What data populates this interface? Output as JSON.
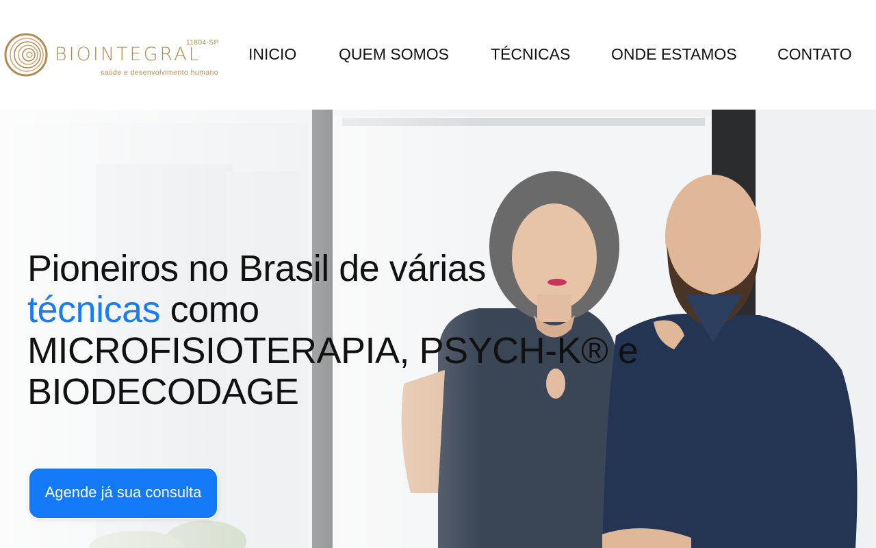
{
  "brand": {
    "name": "BIOINTEGRAL",
    "code": "11804-SP",
    "tagline": "saúde e desenvolvimento humano",
    "color": "#b08a52"
  },
  "nav": {
    "items": [
      {
        "label": "INICIO"
      },
      {
        "label": "QUEM SOMOS"
      },
      {
        "label": "TÉCNICAS"
      },
      {
        "label": "ONDE ESTAMOS"
      },
      {
        "label": "CONTATO"
      }
    ]
  },
  "hero": {
    "headline_part1": "Pioneiros no Brasil de várias",
    "headline_accent": "técnicas",
    "headline_part2": "como",
    "headline_line3": "MICROFISIOTERAPIA, PSYCH-K® e",
    "headline_line4": "BIODECODAGE",
    "accent_color": "#1a7cf2",
    "cta_label": "Agende já sua consulta",
    "cta_color": "#1479f7"
  }
}
